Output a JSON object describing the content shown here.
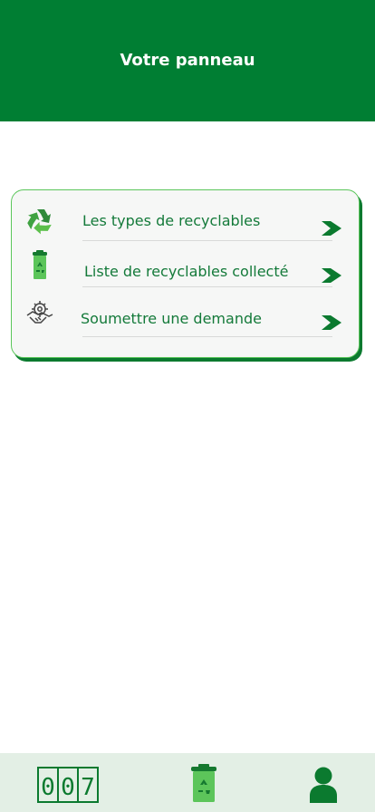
{
  "header": {
    "title": "Votre panneau"
  },
  "menu": {
    "items": [
      {
        "label": "Les types de recyclables",
        "icon": "recycle-icon"
      },
      {
        "label": "Liste de recyclables collecté",
        "icon": "recycle-bin-icon"
      },
      {
        "label": "Soumettre une demande",
        "icon": "handshake-gear-icon"
      }
    ],
    "chevron_icon": "chevron-right-icon"
  },
  "bottom_nav": {
    "items": [
      {
        "icon": "counter-icon",
        "digits": [
          "0",
          "0",
          "7"
        ]
      },
      {
        "icon": "recycle-bin-icon"
      },
      {
        "icon": "user-icon"
      }
    ]
  },
  "colors": {
    "primary": "#007e33",
    "accent_light": "#5bc65b",
    "bottom_bar": "#e3efe5"
  }
}
